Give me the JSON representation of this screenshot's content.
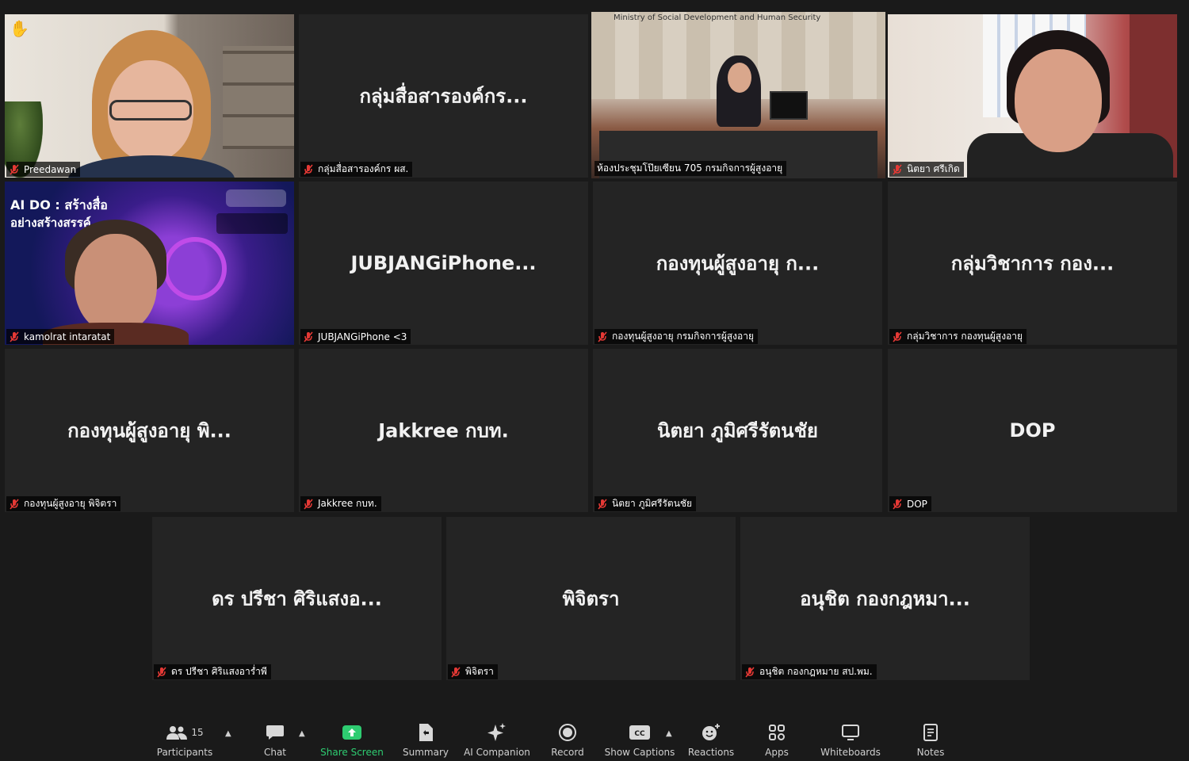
{
  "tiles": [
    {
      "label": "Preedawan",
      "name": "Preedawan"
    },
    {
      "name": "กลุ่มสื่อสารองค์กร...",
      "label": "กลุ่มสื่อสารองค์กร ผส."
    },
    {
      "label": "ห้องประชุมโป๊ยเซียน 705 กรมกิจการผู้สูงอายุ",
      "caption": "Ministry of Social Development and Human Security"
    },
    {
      "label": "นิตยา ศรีเกิด"
    },
    {
      "label": "kamolrat intaratat",
      "slide_title1": "AI DO : สร้างสื่อ",
      "slide_title2": "อย่างสร้างสรรค์"
    },
    {
      "name": "JUBJANGiPhone...",
      "label": "JUBJANGiPhone <3"
    },
    {
      "name": "กองทุนผู้สูงอายุ ก...",
      "label": "กองทุนผู้สูงอายุ กรมกิจการผู้สูงอายุ"
    },
    {
      "name": "กลุ่มวิชาการ กอง...",
      "label": "กลุ่มวิชาการ กองทุนผู้สูงอายุ"
    },
    {
      "name": "กองทุนผู้สูงอายุ พิ...",
      "label": "กองทุนผู้สูงอายุ พิจิตรา"
    },
    {
      "name": "Jakkree กบท.",
      "label": "Jakkree กบท."
    },
    {
      "name": "นิตยา ภูมิศรีรัตนชัย",
      "label": "นิตยา ภูมิศรีรัตนชัย"
    },
    {
      "name": "DOP",
      "label": "DOP"
    },
    {
      "name": "ดร ปรีชา ศิริแสงอ...",
      "label": "ดร ปรีชา ศิริแสงอาร่ำพี"
    },
    {
      "name": "พิจิตรา",
      "label": "พิจิตรา"
    },
    {
      "name": "อนุชิต กองกฎหมา...",
      "label": "อนุชิต กองกฎหมาย สป.พม."
    }
  ],
  "toolbar": {
    "participants_label": "Participants",
    "participants_count": "15",
    "chat_label": "Chat",
    "share_label": "Share Screen",
    "summary_label": "Summary",
    "ai_label": "AI Companion",
    "record_label": "Record",
    "captions_label": "Show Captions",
    "reactions_label": "Reactions",
    "apps_label": "Apps",
    "whiteboards_label": "Whiteboards",
    "notes_label": "Notes"
  },
  "colors": {
    "speaking_outline": "#c8e65a",
    "share_green": "#2ecc71",
    "mute_red": "#e53935"
  }
}
